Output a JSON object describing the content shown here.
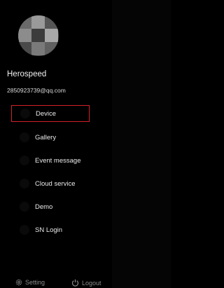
{
  "profile": {
    "username": "Herospeed",
    "email": "2850923739@qq.com"
  },
  "menu": [
    {
      "label": "Device",
      "icon": "device-icon",
      "active": true
    },
    {
      "label": "Gallery",
      "icon": "gallery-icon",
      "active": false
    },
    {
      "label": "Event message",
      "icon": "event-message-icon",
      "active": false
    },
    {
      "label": "Cloud service",
      "icon": "cloud-icon",
      "active": false
    },
    {
      "label": "Demo",
      "icon": "demo-icon",
      "active": false
    },
    {
      "label": "SN Login",
      "icon": "sn-login-icon",
      "active": false
    }
  ],
  "footer": {
    "setting_label": "Setting",
    "logout_label": "Logout"
  },
  "colors": {
    "active_border": "#d4202a",
    "background": "#000000",
    "text": "#e8e8e8",
    "footer_text": "#8a8a8a"
  }
}
